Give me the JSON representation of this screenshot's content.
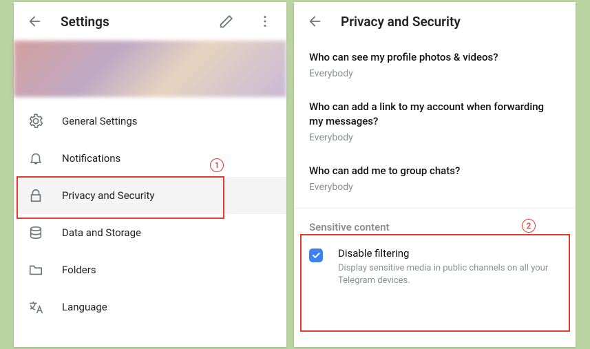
{
  "left": {
    "title": "Settings",
    "menu": [
      {
        "icon": "gear",
        "label": "General Settings"
      },
      {
        "icon": "bell",
        "label": "Notifications"
      },
      {
        "icon": "lock",
        "label": "Privacy and Security"
      },
      {
        "icon": "db",
        "label": "Data and Storage"
      },
      {
        "icon": "folder",
        "label": "Folders"
      },
      {
        "icon": "lang",
        "label": "Language"
      }
    ]
  },
  "right": {
    "title": "Privacy and Security",
    "questions": [
      {
        "q": "Who can see my profile photos & videos?",
        "v": "Everybody"
      },
      {
        "q": "Who can add a link to my account when forwarding my messages?",
        "v": "Everybody"
      },
      {
        "q": "Who can add me to group chats?",
        "v": "Everybody"
      }
    ],
    "section_title": "Sensitive content",
    "checkbox": {
      "checked": true,
      "label": "Disable filtering",
      "desc": "Display sensitive media in public channels on all your Telegram devices."
    }
  },
  "annotations": {
    "one": "1",
    "two": "2"
  }
}
